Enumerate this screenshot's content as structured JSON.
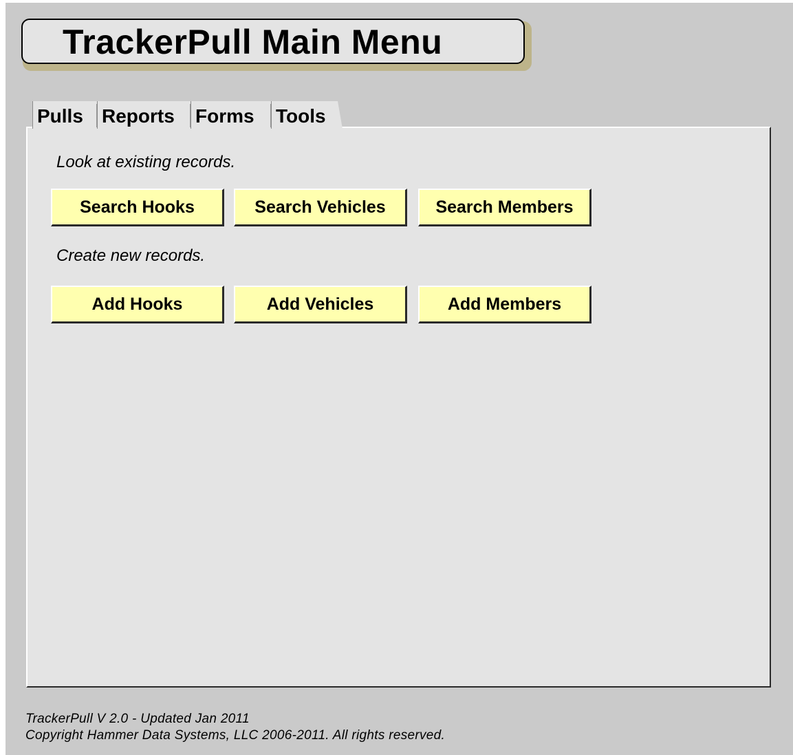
{
  "title": "TrackerPull Main Menu",
  "tabs": [
    {
      "label": "Pulls"
    },
    {
      "label": "Reports"
    },
    {
      "label": "Forms"
    },
    {
      "label": "Tools"
    }
  ],
  "selected_tab": "Forms",
  "sections": {
    "search": {
      "label": "Look at existing records.",
      "buttons": [
        "Search Hooks",
        "Search Vehicles",
        "Search Members"
      ]
    },
    "create": {
      "label": "Create new records.",
      "buttons": [
        "Add Hooks",
        "Add Vehicles",
        "Add Members"
      ]
    }
  },
  "footer": {
    "version": "TrackerPull V 2.0 - Updated Jan 2011",
    "copyright": "Copyright Hammer Data Systems, LLC 2006-2011. All rights reserved."
  },
  "colors": {
    "background": "#cacaca",
    "panel": "#e4e4e4",
    "button": "#ffffaf",
    "title_shadow": "#bdb48a"
  }
}
